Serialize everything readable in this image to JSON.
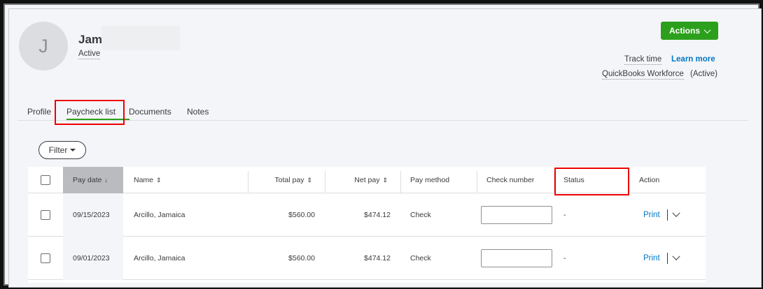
{
  "employee": {
    "initial": "J",
    "name": "Jam",
    "status": "Active"
  },
  "header": {
    "actions_label": "Actions",
    "track_time": "Track time",
    "learn_more": "Learn more",
    "workforce": "QuickBooks Workforce",
    "workforce_status": "(Active)"
  },
  "tabs": [
    {
      "label": "Profile"
    },
    {
      "label": "Paycheck list"
    },
    {
      "label": "Documents"
    },
    {
      "label": "Notes"
    }
  ],
  "filter_label": "Filter",
  "table": {
    "columns": {
      "pay_date": "Pay date",
      "name": "Name",
      "total_pay": "Total pay",
      "net_pay": "Net pay",
      "pay_method": "Pay method",
      "check_number": "Check number",
      "status": "Status",
      "action": "Action"
    },
    "sort_arrow": "↓",
    "sort_both": "⇕",
    "rows": [
      {
        "pay_date": "09/15/2023",
        "name": "Arcillo, Jamaica",
        "total_pay": "$560.00",
        "net_pay": "$474.12",
        "pay_method": "Check",
        "check_number": "",
        "status": "-",
        "action": "Print"
      },
      {
        "pay_date": "09/01/2023",
        "name": "Arcillo, Jamaica",
        "total_pay": "$560.00",
        "net_pay": "$474.12",
        "pay_method": "Check",
        "check_number": "",
        "status": "-",
        "action": "Print"
      }
    ]
  },
  "colors": {
    "accent_green": "#2ca01c",
    "link_blue": "#0077c5",
    "highlight_red": "#e00000"
  }
}
